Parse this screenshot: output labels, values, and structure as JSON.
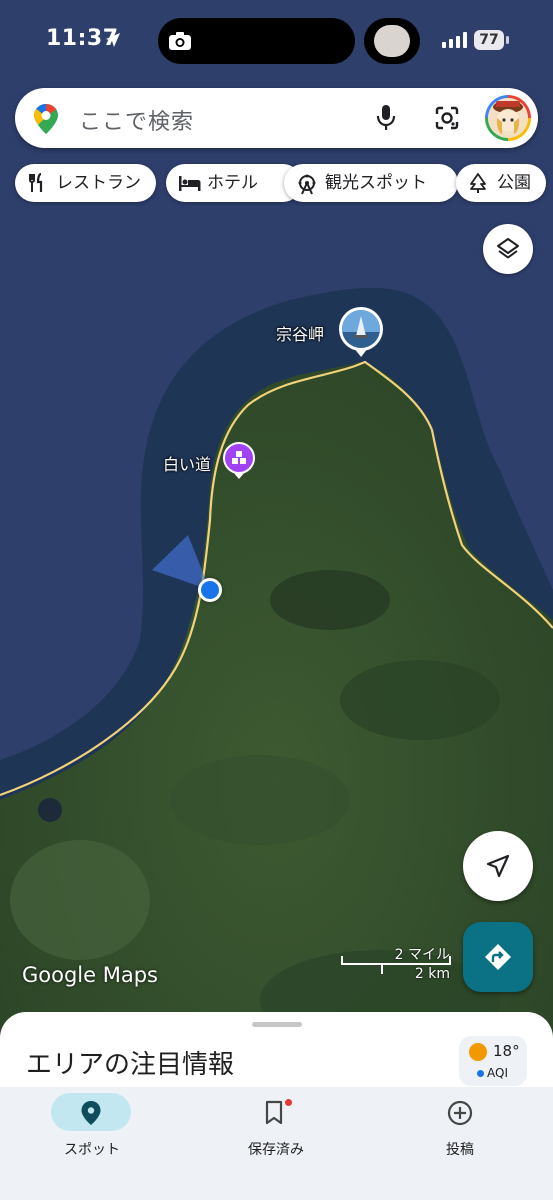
{
  "status_bar": {
    "time": "11:37",
    "battery": "77"
  },
  "search": {
    "placeholder": "ここで検索"
  },
  "chips": [
    {
      "label": "レストラン",
      "icon": "restaurant-icon"
    },
    {
      "label": "ホテル",
      "icon": "hotel-icon"
    },
    {
      "label": "観光スポット",
      "icon": "attraction-icon"
    },
    {
      "label": "公園",
      "icon": "park-icon"
    }
  ],
  "map": {
    "places": [
      {
        "label": "宗谷岬",
        "icon": "photo-pin-icon"
      },
      {
        "label": "白い道",
        "icon": "poi-pin-icon"
      }
    ],
    "scale": {
      "miles": "2 マイル",
      "km": "2 km"
    },
    "watermark": "Google Maps"
  },
  "sheet": {
    "title": "エリアの注目情報",
    "weather": {
      "temperature": "18°",
      "aqi_label": "AQI"
    }
  },
  "tabs": [
    {
      "label": "スポット",
      "active": true
    },
    {
      "label": "保存済み",
      "badge": true
    },
    {
      "label": "投稿"
    }
  ],
  "colors": {
    "accent": "#0b7285",
    "location_blue": "#1a73e8",
    "poi_purple": "#a142f4",
    "road_yellow": "#f1d27a"
  }
}
